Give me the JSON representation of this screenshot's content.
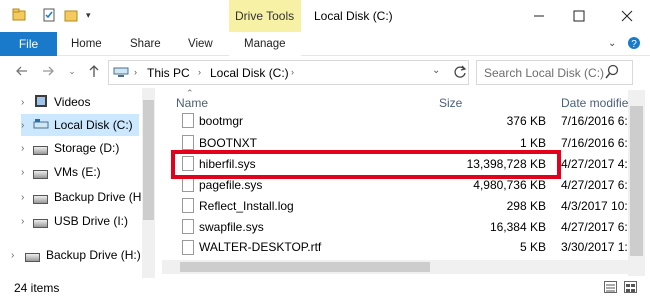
{
  "window": {
    "context_tab": "Drive Tools",
    "title": "Local Disk (C:)"
  },
  "ribbon": {
    "file": "File",
    "home": "Home",
    "share": "Share",
    "view": "View",
    "manage": "Manage"
  },
  "address": {
    "crumbs": [
      "This PC",
      "Local Disk (C:)"
    ]
  },
  "search": {
    "placeholder": "Search Local Disk (C:)"
  },
  "nav": {
    "items": [
      {
        "label": "Videos",
        "icon": "videos-folder-icon"
      },
      {
        "label": "Local Disk (C:)",
        "icon": "drive-icon"
      },
      {
        "label": "Storage (D:)",
        "icon": "drive-icon"
      },
      {
        "label": "VMs (E:)",
        "icon": "drive-icon"
      },
      {
        "label": "Backup Drive (H",
        "icon": "drive-icon"
      },
      {
        "label": "USB Drive (I:)",
        "icon": "drive-icon"
      },
      {
        "label": "Backup Drive (H:)",
        "icon": "drive-icon"
      }
    ]
  },
  "columns": {
    "name": "Name",
    "size": "Size",
    "date": "Date modifie"
  },
  "files": [
    {
      "name": "bootmgr",
      "size": "376 KB",
      "date": "7/16/2016 6:4"
    },
    {
      "name": "BOOTNXT",
      "size": "1 KB",
      "date": "7/16/2016 6:4"
    },
    {
      "name": "hiberfil.sys",
      "size": "13,398,728 KB",
      "date": "4/27/2017 4:3"
    },
    {
      "name": "pagefile.sys",
      "size": "4,980,736 KB",
      "date": "4/27/2017 6:0"
    },
    {
      "name": "Reflect_Install.log",
      "size": "298 KB",
      "date": "4/3/2017 10:1"
    },
    {
      "name": "swapfile.sys",
      "size": "16,384 KB",
      "date": "4/27/2017 6:0"
    },
    {
      "name": "WALTER-DESKTOP.rtf",
      "size": "5 KB",
      "date": "3/30/2017 1:"
    }
  ],
  "status": {
    "items": "24 items"
  },
  "colors": {
    "file_tab": "#1979ca",
    "context_tab_bg": "#f7f1a6",
    "selection": "#cce8ff",
    "highlight": "#e2001a",
    "header_text": "#4c607a"
  }
}
